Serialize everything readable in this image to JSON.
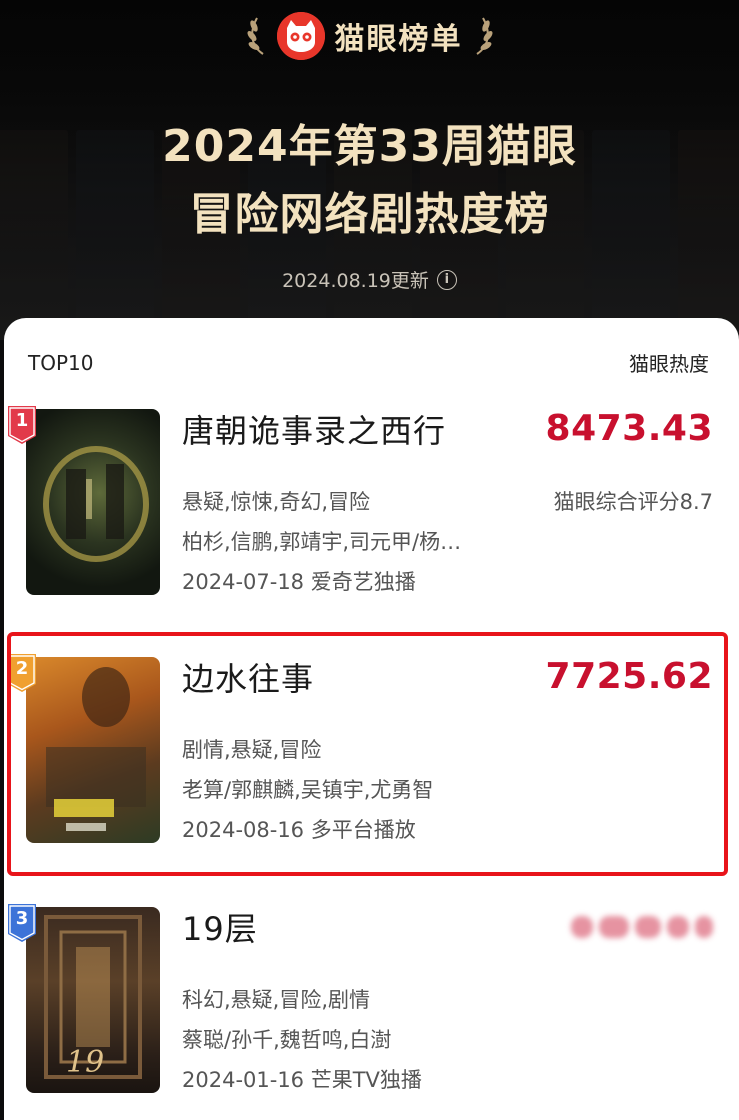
{
  "header": {
    "brand_name": "猫眼榜单",
    "title_line1": "2024年第33周猫眼",
    "title_line2": "冒险网络剧热度榜",
    "update_text": "2024.08.19更新"
  },
  "list": {
    "left_label": "TOP10",
    "right_label": "猫眼热度",
    "items": [
      {
        "rank": "1",
        "title": "唐朝诡事录之西行",
        "score": "8473.43",
        "rating": "猫眼综合评分8.7",
        "genres": "悬疑,惊悚,奇幻,冒险",
        "cast": "柏杉,信鹏,郭靖宇,司元甲/杨…",
        "release": "2024-07-18 爱奇艺独播",
        "badge_color": "#e23a4a"
      },
      {
        "rank": "2",
        "title": "边水往事",
        "score": "7725.62",
        "genres": "剧情,悬疑,冒险",
        "cast": "老算/郭麒麟,吴镇宇,尤勇智",
        "release": "2024-08-16 多平台播放",
        "badge_color": "#f0a030"
      },
      {
        "rank": "3",
        "title": "19层",
        "genres": "科幻,悬疑,冒险,剧情",
        "cast": "蔡聪/孙千,魏哲鸣,白澍",
        "release": "2024-01-16 芒果TV独播",
        "badge_color": "#3c73d8"
      }
    ]
  },
  "colors": {
    "score_red": "#c8102e",
    "header_gold": "#f3e2bf",
    "highlight_border": "#e8141a",
    "brand_red": "#e8362a"
  }
}
